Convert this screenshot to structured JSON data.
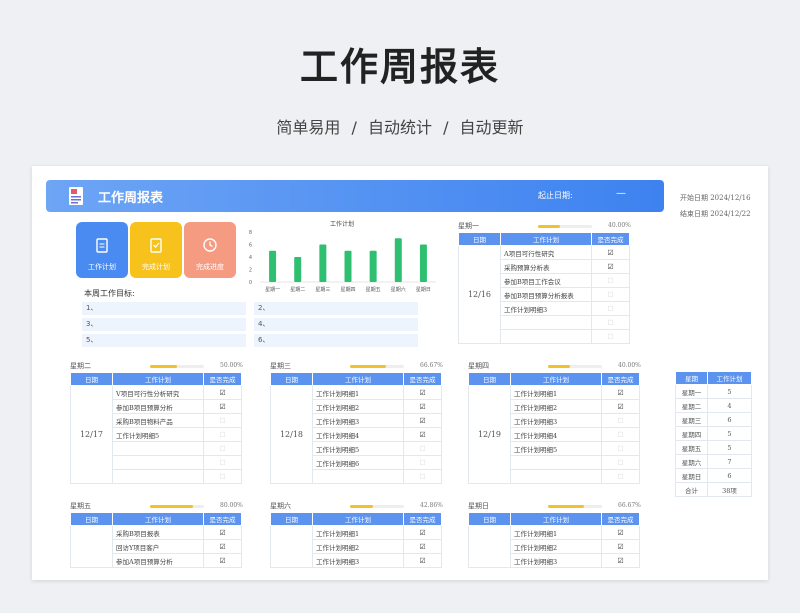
{
  "hero": {
    "title": "工作周报表",
    "subtitle": "简单易用  /  自动统计  /  自动更新"
  },
  "banner": {
    "title": "工作周报表",
    "range_label": "起止日期:",
    "range_value": "—"
  },
  "dates": {
    "start": "开始日期 2024/12/16",
    "end": "结束日期 2024/12/22"
  },
  "quick": [
    {
      "label": "工作计划",
      "icon": "clipboard-icon",
      "color": "#4a8bf2"
    },
    {
      "label": "完成计划",
      "icon": "checklist-icon",
      "color": "#f7c21b"
    },
    {
      "label": "完成进度",
      "icon": "clock-icon",
      "color": "#f59b82"
    }
  ],
  "goals": {
    "title": "本周工作目标:",
    "items": [
      "1、",
      "2、",
      "3、",
      "4、",
      "5、",
      "6、"
    ]
  },
  "table_headers": {
    "date": "日期",
    "plan": "工作计划",
    "done": "是否完成"
  },
  "chart_data": {
    "type": "bar",
    "title": "工作计划",
    "categories": [
      "星期一",
      "星期二",
      "星期三",
      "星期四",
      "星期五",
      "星期六",
      "星期日"
    ],
    "values": [
      5,
      4,
      6,
      5,
      5,
      7,
      6
    ],
    "ylim": [
      0,
      8
    ],
    "yticks": [
      "8",
      "6",
      "4",
      "2",
      "0"
    ],
    "color": "#2fbf71",
    "grid": false
  },
  "days": [
    {
      "name": "星期一",
      "date": "12/16",
      "progress": 0.4,
      "pct": "40.00%",
      "rows": [
        {
          "plan": "A项目可行性研究",
          "done": true
        },
        {
          "plan": "采购预算分析表",
          "done": true
        },
        {
          "plan": "参加B项目工作会议",
          "done": false
        },
        {
          "plan": "参加B项目预算分析报表",
          "done": false
        },
        {
          "plan": "工作计划明细3",
          "done": false
        },
        {
          "plan": "",
          "done": false
        },
        {
          "plan": "",
          "done": false
        }
      ]
    },
    {
      "name": "星期二",
      "date": "12/17",
      "progress": 0.5,
      "pct": "50.00%",
      "rows": [
        {
          "plan": "V项目可行性分析研究",
          "done": true
        },
        {
          "plan": "参加B项目预算分析",
          "done": true
        },
        {
          "plan": "采购B项目物料产品",
          "done": false
        },
        {
          "plan": "工作计划明细5",
          "done": false
        },
        {
          "plan": "",
          "done": false
        },
        {
          "plan": "",
          "done": false
        },
        {
          "plan": "",
          "done": false
        }
      ]
    },
    {
      "name": "星期三",
      "date": "12/18",
      "progress": 0.6667,
      "pct": "66.67%",
      "rows": [
        {
          "plan": "工作计划明细1",
          "done": true
        },
        {
          "plan": "工作计划明细2",
          "done": true
        },
        {
          "plan": "工作计划明细3",
          "done": true
        },
        {
          "plan": "工作计划明细4",
          "done": true
        },
        {
          "plan": "工作计划明细5",
          "done": false
        },
        {
          "plan": "工作计划明细6",
          "done": false
        },
        {
          "plan": "",
          "done": false
        }
      ]
    },
    {
      "name": "星期四",
      "date": "12/19",
      "progress": 0.4,
      "pct": "40.00%",
      "rows": [
        {
          "plan": "工作计划明细1",
          "done": true
        },
        {
          "plan": "工作计划明细2",
          "done": true
        },
        {
          "plan": "工作计划明细3",
          "done": false
        },
        {
          "plan": "工作计划明细4",
          "done": false
        },
        {
          "plan": "工作计划明细5",
          "done": false
        },
        {
          "plan": "",
          "done": false
        },
        {
          "plan": "",
          "done": false
        }
      ]
    },
    {
      "name": "星期五",
      "date": "",
      "progress": 0.8,
      "pct": "80.00%",
      "rows": [
        {
          "plan": "采购B项目报表",
          "done": true
        },
        {
          "plan": "回访Y项目客户",
          "done": true
        },
        {
          "plan": "参加A项目预算分析",
          "done": true
        }
      ]
    },
    {
      "name": "星期六",
      "date": "",
      "progress": 0.4286,
      "pct": "42.86%",
      "rows": [
        {
          "plan": "工作计划明细1",
          "done": true
        },
        {
          "plan": "工作计划明细2",
          "done": true
        },
        {
          "plan": "工作计划明细3",
          "done": true
        }
      ]
    },
    {
      "name": "星期日",
      "date": "",
      "progress": 0.6667,
      "pct": "66.67%",
      "rows": [
        {
          "plan": "工作计划明细1",
          "done": true
        },
        {
          "plan": "工作计划明细2",
          "done": true
        },
        {
          "plan": "工作计划明细3",
          "done": true
        }
      ]
    }
  ],
  "summary": {
    "headers": [
      "星期",
      "工作计划"
    ],
    "rows": [
      [
        "星期一",
        "5"
      ],
      [
        "星期二",
        "4"
      ],
      [
        "星期三",
        "6"
      ],
      [
        "星期四",
        "5"
      ],
      [
        "星期五",
        "5"
      ],
      [
        "星期六",
        "7"
      ],
      [
        "星期日",
        "6"
      ],
      [
        "合计",
        "38项"
      ]
    ]
  },
  "colors": {
    "accent": "#3d82f0",
    "header": "#5b93ee",
    "progress": "#f2c22b",
    "bar": "#2fbf71"
  }
}
